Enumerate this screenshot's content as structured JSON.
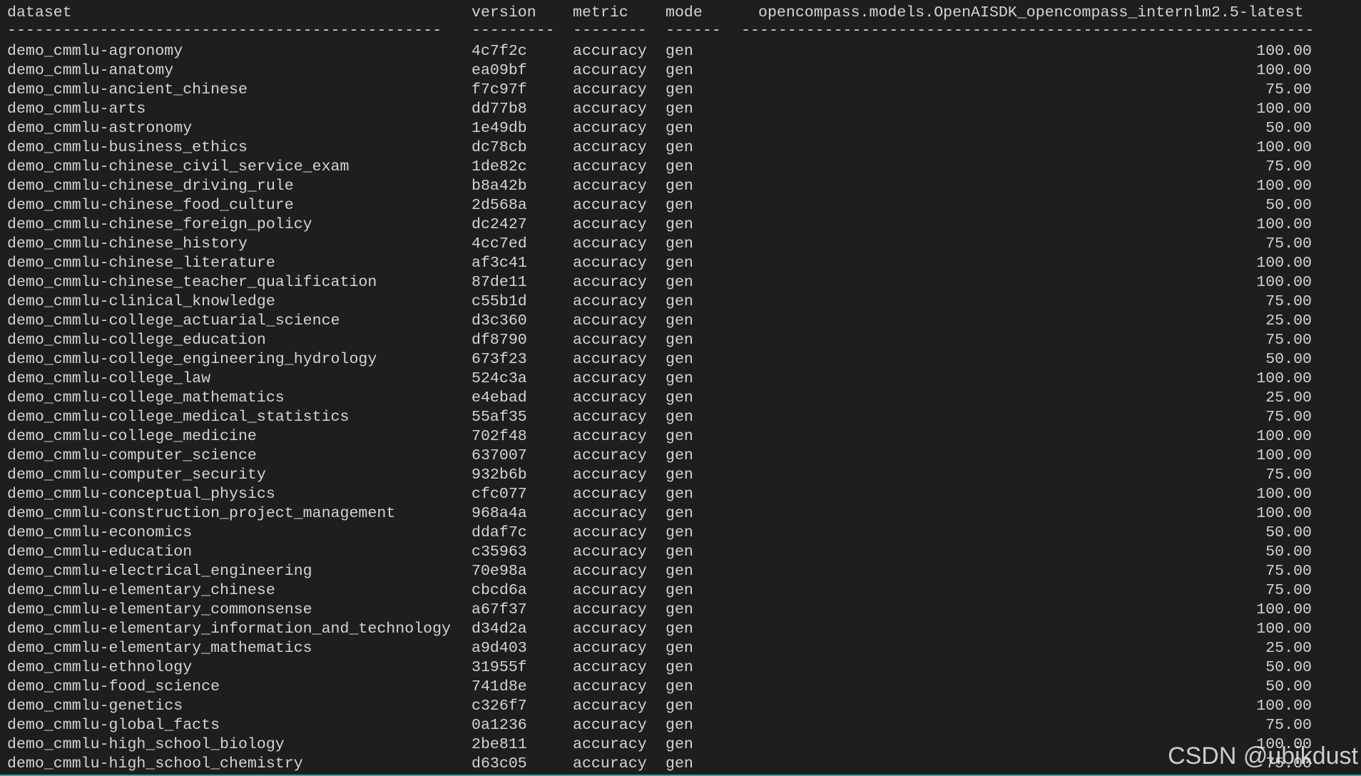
{
  "header": {
    "dataset": "dataset",
    "version": "version",
    "metric": "metric",
    "mode": "mode",
    "model": "opencompass.models.OpenAISDK_opencompass_internlm2.5-latest"
  },
  "separator": {
    "dataset": "-----------------------------------------------",
    "version": "---------",
    "metric": "--------",
    "mode": "------",
    "model": "--------------------------------------------------------------"
  },
  "rows": [
    {
      "dataset": "demo_cmmlu-agronomy",
      "version": "4c7f2c",
      "metric": "accuracy",
      "mode": "gen",
      "score": "100.00"
    },
    {
      "dataset": "demo_cmmlu-anatomy",
      "version": "ea09bf",
      "metric": "accuracy",
      "mode": "gen",
      "score": "100.00"
    },
    {
      "dataset": "demo_cmmlu-ancient_chinese",
      "version": "f7c97f",
      "metric": "accuracy",
      "mode": "gen",
      "score": "75.00"
    },
    {
      "dataset": "demo_cmmlu-arts",
      "version": "dd77b8",
      "metric": "accuracy",
      "mode": "gen",
      "score": "100.00"
    },
    {
      "dataset": "demo_cmmlu-astronomy",
      "version": "1e49db",
      "metric": "accuracy",
      "mode": "gen",
      "score": "50.00"
    },
    {
      "dataset": "demo_cmmlu-business_ethics",
      "version": "dc78cb",
      "metric": "accuracy",
      "mode": "gen",
      "score": "100.00"
    },
    {
      "dataset": "demo_cmmlu-chinese_civil_service_exam",
      "version": "1de82c",
      "metric": "accuracy",
      "mode": "gen",
      "score": "75.00"
    },
    {
      "dataset": "demo_cmmlu-chinese_driving_rule",
      "version": "b8a42b",
      "metric": "accuracy",
      "mode": "gen",
      "score": "100.00"
    },
    {
      "dataset": "demo_cmmlu-chinese_food_culture",
      "version": "2d568a",
      "metric": "accuracy",
      "mode": "gen",
      "score": "50.00"
    },
    {
      "dataset": "demo_cmmlu-chinese_foreign_policy",
      "version": "dc2427",
      "metric": "accuracy",
      "mode": "gen",
      "score": "100.00"
    },
    {
      "dataset": "demo_cmmlu-chinese_history",
      "version": "4cc7ed",
      "metric": "accuracy",
      "mode": "gen",
      "score": "75.00"
    },
    {
      "dataset": "demo_cmmlu-chinese_literature",
      "version": "af3c41",
      "metric": "accuracy",
      "mode": "gen",
      "score": "100.00"
    },
    {
      "dataset": "demo_cmmlu-chinese_teacher_qualification",
      "version": "87de11",
      "metric": "accuracy",
      "mode": "gen",
      "score": "100.00"
    },
    {
      "dataset": "demo_cmmlu-clinical_knowledge",
      "version": "c55b1d",
      "metric": "accuracy",
      "mode": "gen",
      "score": "75.00"
    },
    {
      "dataset": "demo_cmmlu-college_actuarial_science",
      "version": "d3c360",
      "metric": "accuracy",
      "mode": "gen",
      "score": "25.00"
    },
    {
      "dataset": "demo_cmmlu-college_education",
      "version": "df8790",
      "metric": "accuracy",
      "mode": "gen",
      "score": "75.00"
    },
    {
      "dataset": "demo_cmmlu-college_engineering_hydrology",
      "version": "673f23",
      "metric": "accuracy",
      "mode": "gen",
      "score": "50.00"
    },
    {
      "dataset": "demo_cmmlu-college_law",
      "version": "524c3a",
      "metric": "accuracy",
      "mode": "gen",
      "score": "100.00"
    },
    {
      "dataset": "demo_cmmlu-college_mathematics",
      "version": "e4ebad",
      "metric": "accuracy",
      "mode": "gen",
      "score": "25.00"
    },
    {
      "dataset": "demo_cmmlu-college_medical_statistics",
      "version": "55af35",
      "metric": "accuracy",
      "mode": "gen",
      "score": "75.00"
    },
    {
      "dataset": "demo_cmmlu-college_medicine",
      "version": "702f48",
      "metric": "accuracy",
      "mode": "gen",
      "score": "100.00"
    },
    {
      "dataset": "demo_cmmlu-computer_science",
      "version": "637007",
      "metric": "accuracy",
      "mode": "gen",
      "score": "100.00"
    },
    {
      "dataset": "demo_cmmlu-computer_security",
      "version": "932b6b",
      "metric": "accuracy",
      "mode": "gen",
      "score": "75.00"
    },
    {
      "dataset": "demo_cmmlu-conceptual_physics",
      "version": "cfc077",
      "metric": "accuracy",
      "mode": "gen",
      "score": "100.00"
    },
    {
      "dataset": "demo_cmmlu-construction_project_management",
      "version": "968a4a",
      "metric": "accuracy",
      "mode": "gen",
      "score": "100.00"
    },
    {
      "dataset": "demo_cmmlu-economics",
      "version": "ddaf7c",
      "metric": "accuracy",
      "mode": "gen",
      "score": "50.00"
    },
    {
      "dataset": "demo_cmmlu-education",
      "version": "c35963",
      "metric": "accuracy",
      "mode": "gen",
      "score": "50.00"
    },
    {
      "dataset": "demo_cmmlu-electrical_engineering",
      "version": "70e98a",
      "metric": "accuracy",
      "mode": "gen",
      "score": "75.00"
    },
    {
      "dataset": "demo_cmmlu-elementary_chinese",
      "version": "cbcd6a",
      "metric": "accuracy",
      "mode": "gen",
      "score": "75.00"
    },
    {
      "dataset": "demo_cmmlu-elementary_commonsense",
      "version": "a67f37",
      "metric": "accuracy",
      "mode": "gen",
      "score": "100.00"
    },
    {
      "dataset": "demo_cmmlu-elementary_information_and_technology",
      "version": "d34d2a",
      "metric": "accuracy",
      "mode": "gen",
      "score": "100.00"
    },
    {
      "dataset": "demo_cmmlu-elementary_mathematics",
      "version": "a9d403",
      "metric": "accuracy",
      "mode": "gen",
      "score": "25.00"
    },
    {
      "dataset": "demo_cmmlu-ethnology",
      "version": "31955f",
      "metric": "accuracy",
      "mode": "gen",
      "score": "50.00"
    },
    {
      "dataset": "demo_cmmlu-food_science",
      "version": "741d8e",
      "metric": "accuracy",
      "mode": "gen",
      "score": "50.00"
    },
    {
      "dataset": "demo_cmmlu-genetics",
      "version": "c326f7",
      "metric": "accuracy",
      "mode": "gen",
      "score": "100.00"
    },
    {
      "dataset": "demo_cmmlu-global_facts",
      "version": "0a1236",
      "metric": "accuracy",
      "mode": "gen",
      "score": "75.00"
    },
    {
      "dataset": "demo_cmmlu-high_school_biology",
      "version": "2be811",
      "metric": "accuracy",
      "mode": "gen",
      "score": "100.00"
    },
    {
      "dataset": "demo_cmmlu-high_school_chemistry",
      "version": "d63c05",
      "metric": "accuracy",
      "mode": "gen",
      "score": "75.00"
    }
  ],
  "watermark": "CSDN @ubikdust",
  "colors": {
    "background": "#1e1e1e",
    "text": "#d4d4d4"
  }
}
